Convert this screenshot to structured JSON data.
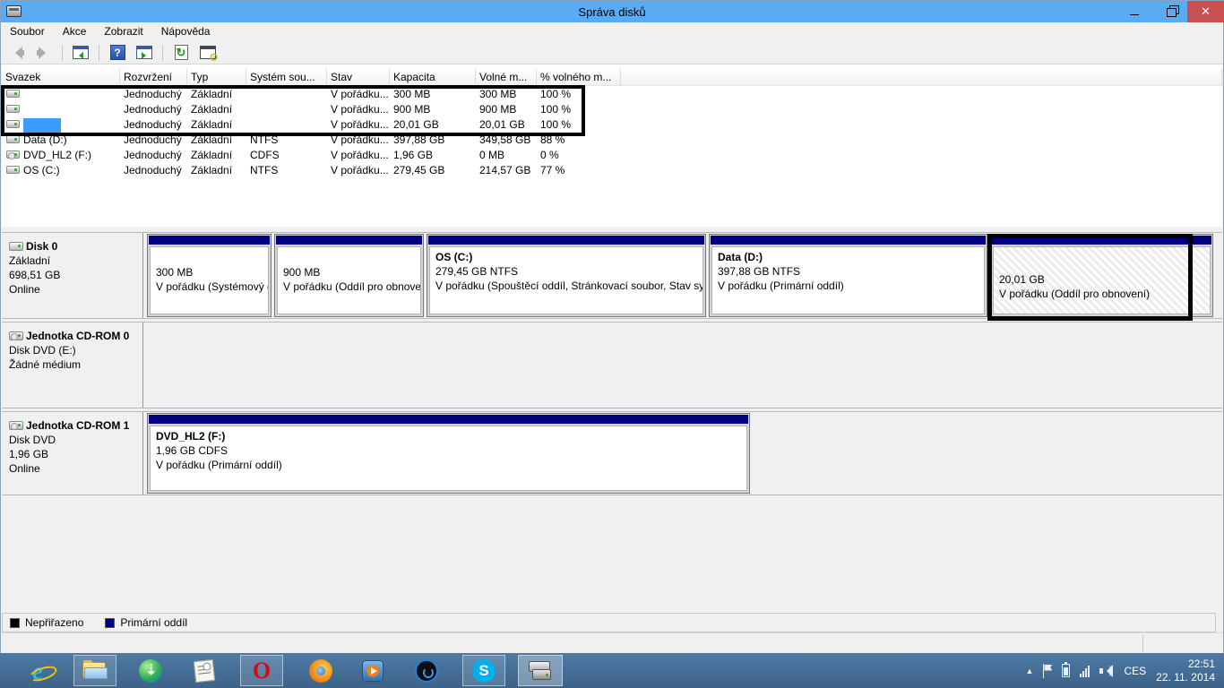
{
  "window": {
    "title": "Správa disků"
  },
  "menu": {
    "items": [
      {
        "label": "Soubor"
      },
      {
        "label": "Akce"
      },
      {
        "label": "Zobrazit"
      },
      {
        "label": "Nápověda"
      }
    ]
  },
  "toolbar": {
    "help_glyph": "?",
    "refresh_glyph": "↻"
  },
  "volume_list": {
    "columns": [
      {
        "label": "Svazek"
      },
      {
        "label": "Rozvržení"
      },
      {
        "label": "Typ"
      },
      {
        "label": "Systém sou..."
      },
      {
        "label": "Stav"
      },
      {
        "label": "Kapacita"
      },
      {
        "label": "Volné m..."
      },
      {
        "label": "% volného m..."
      }
    ],
    "rows": [
      {
        "name": "",
        "layout": "Jednoduchý",
        "type": "Základní",
        "filesystem": "",
        "status": "V pořádku...",
        "capacity": "300 MB",
        "free_space": "300 MB",
        "percent_free": "100 %"
      },
      {
        "name": "",
        "layout": "Jednoduchý",
        "type": "Základní",
        "filesystem": "",
        "status": "V pořádku...",
        "capacity": "900 MB",
        "free_space": "900 MB",
        "percent_free": "100 %"
      },
      {
        "name": "",
        "layout": "Jednoduchý",
        "type": "Základní",
        "filesystem": "",
        "status": "V pořádku...",
        "capacity": "20,01 GB",
        "free_space": "20,01 GB",
        "percent_free": "100 %"
      },
      {
        "name": "Data (D:)",
        "layout": "Jednoduchý",
        "type": "Základní",
        "filesystem": "NTFS",
        "status": "V pořádku...",
        "capacity": "397,88 GB",
        "free_space": "349,58 GB",
        "percent_free": "88 %"
      },
      {
        "name": "DVD_HL2 (F:)",
        "layout": "Jednoduchý",
        "type": "Základní",
        "filesystem": "CDFS",
        "status": "V pořádku...",
        "capacity": "1,96 GB",
        "free_space": "0 MB",
        "percent_free": "0 %"
      },
      {
        "name": "OS (C:)",
        "layout": "Jednoduchý",
        "type": "Základní",
        "filesystem": "NTFS",
        "status": "V pořádku...",
        "capacity": "279,45 GB",
        "free_space": "214,57 GB",
        "percent_free": "77 %"
      }
    ]
  },
  "graphical_view": {
    "disk0": {
      "title": "Disk 0",
      "line1": "Základní",
      "line2": "698,51 GB",
      "line3": "Online",
      "partitions": [
        {
          "name": "",
          "size_line": "300 MB",
          "status_line": "V pořádku (Systémový c"
        },
        {
          "name": "",
          "size_line": "900 MB",
          "status_line": "V pořádku (Oddíl pro obnove"
        },
        {
          "name": "OS (C:)",
          "size_line": "279,45 GB NTFS",
          "status_line": "V pořádku (Spouštěcí oddíl, Stránkovací soubor, Stav syst"
        },
        {
          "name": "Data (D:)",
          "size_line": "397,88 GB NTFS",
          "status_line": "V pořádku (Primární oddíl)"
        },
        {
          "name": "",
          "size_line": "20,01 GB",
          "status_line": "V pořádku (Oddíl pro obnovení)"
        }
      ]
    },
    "cdrom0": {
      "title": "Jednotka CD-ROM 0",
      "line1": "Disk DVD (E:)",
      "line2": "",
      "line3": "Žádné médium"
    },
    "cdrom1": {
      "title": "Jednotka CD-ROM 1",
      "line1": "Disk DVD",
      "line2": "1,96 GB",
      "line3": "Online",
      "partition": {
        "name": "DVD_HL2 (F:)",
        "size_line": "1,96 GB CDFS",
        "status_line": "V pořádku (Primární oddíl)"
      }
    }
  },
  "legend": {
    "items": [
      {
        "label": "Nepřiřazeno",
        "color": "#000000"
      },
      {
        "label": "Primární oddíl",
        "color": "#000080"
      }
    ]
  },
  "taskbar": {
    "glyphs": {
      "ie": "e",
      "opera": "O",
      "skype": "S"
    }
  },
  "tray": {
    "language": "CES",
    "time": "22:51",
    "date": "22. 11. 2014"
  },
  "colors": {
    "titlebar": "#5aabf3",
    "partition_stripe": "#000080",
    "selection_annotation": "#3d9bfd",
    "annotation": "#000000",
    "close_button": "#c75050"
  }
}
